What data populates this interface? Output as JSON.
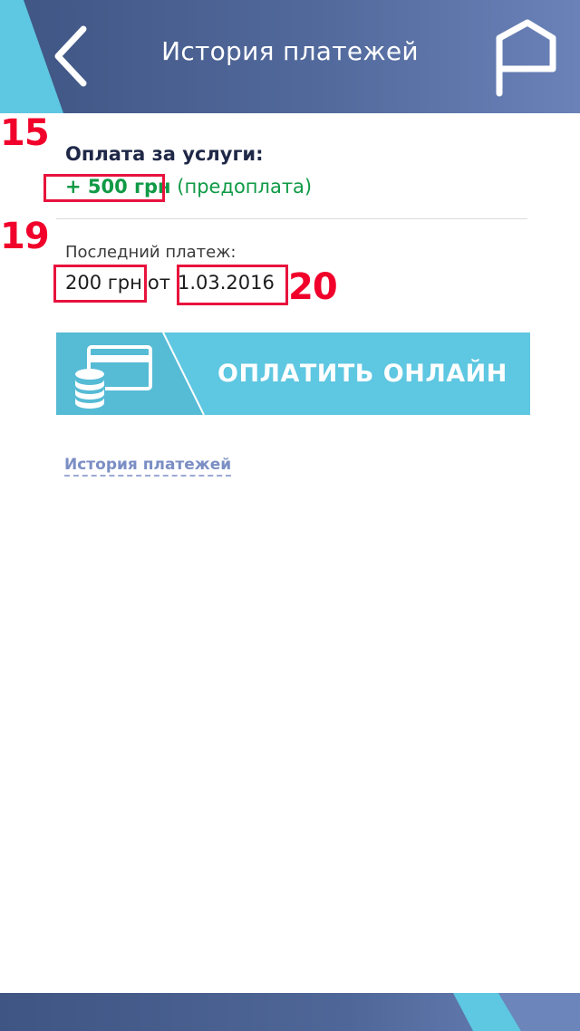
{
  "header": {
    "title": "История платежей",
    "back_icon": "chevron-left-icon",
    "flag_icon": "flag-icon"
  },
  "services": {
    "title": "Оплата за услуги:",
    "amount": "+ 500 грн",
    "note": "(предоплата)"
  },
  "last_payment": {
    "label": "Последний платеж:",
    "amount": "200 грн",
    "separator": "от",
    "date": "1.03.2016"
  },
  "pay_button": {
    "label": "ОПЛАТИТЬ ОНЛАЙН",
    "icon": "card-coins-icon"
  },
  "history_link": "История платежей",
  "annotations": {
    "a15": "15",
    "a19": "19",
    "a20": "20"
  },
  "colors": {
    "header": "#4a6193",
    "accent_cyan": "#5ec7e1",
    "green": "#0f9a46",
    "annotation_red": "#f0002a",
    "link": "#7b8ec4"
  }
}
